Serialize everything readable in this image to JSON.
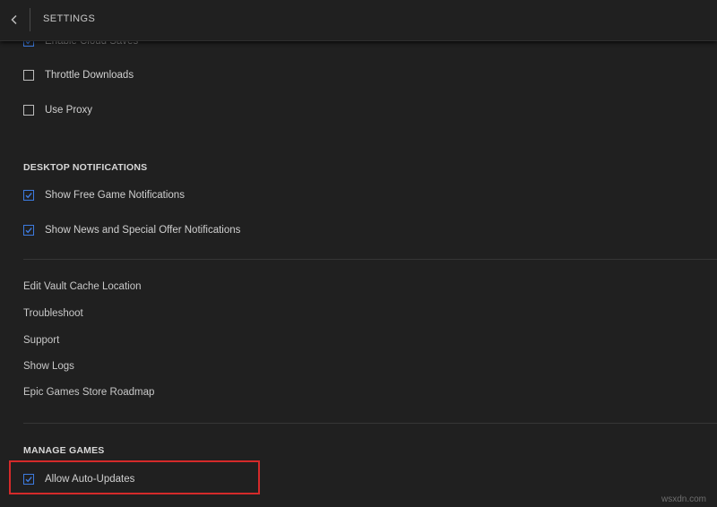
{
  "header": {
    "title": "SETTINGS"
  },
  "partial_row": {
    "label": "Enable Cloud Saves",
    "checked": true
  },
  "network": [
    {
      "label": "Throttle Downloads",
      "checked": false
    },
    {
      "label": "Use Proxy",
      "checked": false
    }
  ],
  "desktop_notifications": {
    "heading": "DESKTOP NOTIFICATIONS",
    "items": [
      {
        "label": "Show Free Game Notifications",
        "checked": true
      },
      {
        "label": "Show News and Special Offer Notifications",
        "checked": true
      }
    ]
  },
  "links": [
    "Edit Vault Cache Location",
    "Troubleshoot",
    "Support",
    "Show Logs",
    "Epic Games Store Roadmap"
  ],
  "manage_games": {
    "heading": "MANAGE GAMES",
    "items": [
      {
        "label": "Allow Auto-Updates",
        "checked": true
      }
    ]
  },
  "watermark": "wsxdn.com",
  "colors": {
    "checkbox_checked": "#3d7be0",
    "highlight": "#d42a2a",
    "background": "#202020"
  }
}
